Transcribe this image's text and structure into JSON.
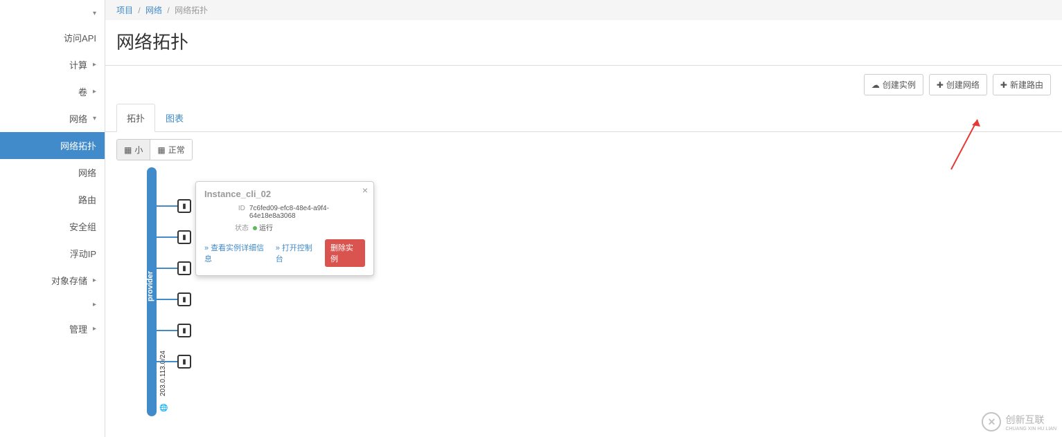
{
  "sidebar": {
    "api_access": "访问API",
    "compute": "计算",
    "volumes": "卷",
    "network": "网络",
    "network_items": {
      "topology": "网络拓扑",
      "networks": "网络",
      "routers": "路由",
      "security_groups": "安全组",
      "floating_ips": "浮动IP"
    },
    "object_storage": "对象存储",
    "admin": "管理"
  },
  "breadcrumb": {
    "project": "项目",
    "network": "网络",
    "current": "网络拓扑"
  },
  "page": {
    "title": "网络拓扑"
  },
  "actions": {
    "launch_instance": "创建实例",
    "create_network": "创建网络",
    "create_router": "新建路由"
  },
  "tabs": {
    "topology": "拓扑",
    "graph": "图表"
  },
  "toolbar": {
    "small": "小",
    "normal": "正常"
  },
  "topology": {
    "network_name": "provider",
    "cidr": "203.0.113.0/24"
  },
  "popover": {
    "title": "Instance_cli_02",
    "id_label": "ID",
    "id_value": "7c6fed09-efc8-48e4-a9f4-64e18e8a3068",
    "status_label": "状态",
    "status_value": "运行",
    "view_details": "» 查看实例详细信息",
    "open_console": "» 打开控制台",
    "delete": "删除实例"
  },
  "watermark": {
    "text": "创新互联",
    "sub": "CHUANG XIN HU LIAN"
  }
}
